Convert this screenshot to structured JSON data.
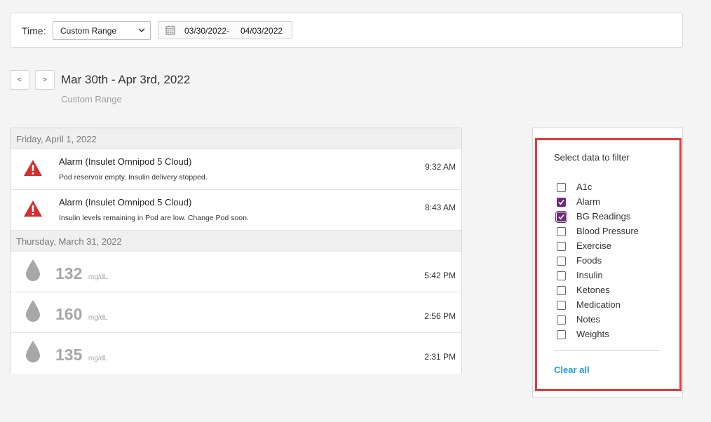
{
  "time_bar": {
    "label": "Time:",
    "select_value": "Custom Range",
    "date_from": "03/30/2022",
    "date_to": "04/03/2022",
    "date_sep": "-"
  },
  "nav": {
    "prev": "<",
    "next": ">",
    "range_title": "Mar 30th - Apr 3rd, 2022",
    "range_subtitle": "Custom Range"
  },
  "log": {
    "days": [
      {
        "header": "Friday, April 1, 2022",
        "entries": [
          {
            "title": "Alarm (Insulet Omnipod 5 Cloud)",
            "desc": "Pod reservoir empty. Insulin delivery stopped.",
            "time": "9:32 AM"
          },
          {
            "title": "Alarm (Insulet Omnipod 5 Cloud)",
            "desc": "Insulin levels remaining in Pod are low. Change Pod soon.",
            "time": "8:43 AM"
          }
        ]
      },
      {
        "header": "Thursday, March 31, 2022",
        "entries": [
          {
            "value": "132",
            "unit": "mg/dL",
            "time": "5:42 PM"
          },
          {
            "value": "160",
            "unit": "mg/dL",
            "time": "2:56 PM"
          },
          {
            "value": "135",
            "unit": "mg/dL",
            "time": "2:31 PM"
          }
        ]
      }
    ]
  },
  "filter": {
    "heading": "Select data to filter",
    "options": [
      {
        "label": "A1c",
        "checked": false
      },
      {
        "label": "Alarm",
        "checked": true
      },
      {
        "label": "BG Readings",
        "checked": true
      },
      {
        "label": "Blood Pressure",
        "checked": false
      },
      {
        "label": "Exercise",
        "checked": false
      },
      {
        "label": "Foods",
        "checked": false
      },
      {
        "label": "Insulin",
        "checked": false
      },
      {
        "label": "Ketones",
        "checked": false
      },
      {
        "label": "Medication",
        "checked": false
      },
      {
        "label": "Notes",
        "checked": false
      },
      {
        "label": "Weights",
        "checked": false
      }
    ],
    "clear_label": "Clear all"
  },
  "colors": {
    "accent_purple": "#6f2a7d",
    "highlight_red": "#e53935",
    "link_blue": "#1e9be0",
    "alarm_red": "#d32f2f"
  }
}
